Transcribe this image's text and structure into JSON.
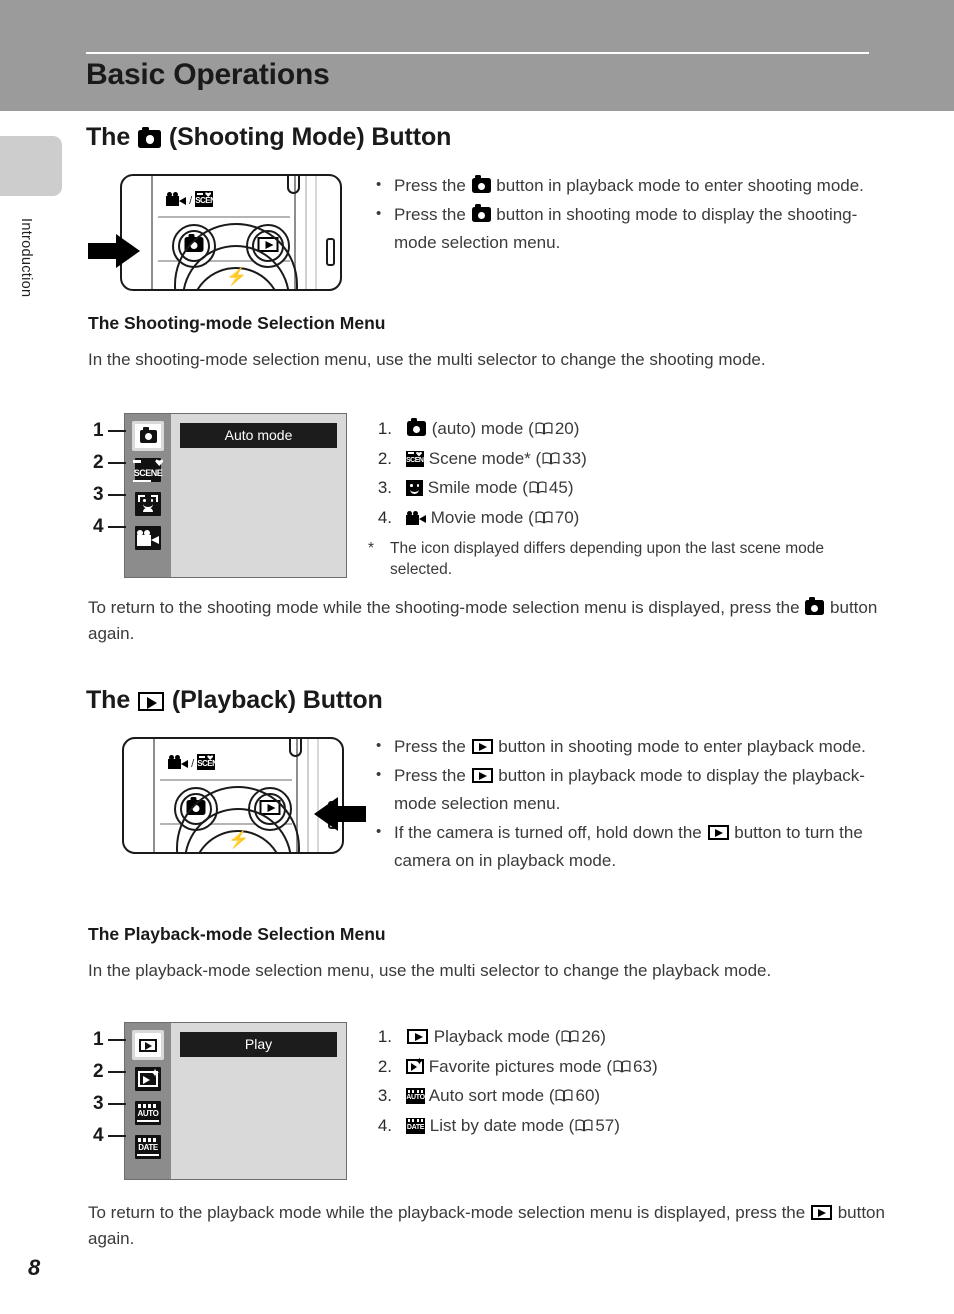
{
  "header": {
    "title": "Basic Operations"
  },
  "side_tab": {
    "label": "Introduction"
  },
  "page_number": "8",
  "sections": [
    {
      "heading_prefix": "The",
      "heading_icon": "shooting-mode-camera-icon",
      "heading_suffix": "(Shooting Mode) Button",
      "bullets": [
        {
          "pre": "Press the",
          "icon": "camera-icon",
          "post": "button in playback mode to enter shooting mode."
        },
        {
          "pre": "Press the",
          "icon": "camera-icon",
          "post": "button in shooting mode to display the shooting-mode selection menu."
        }
      ],
      "sub_heading": "The Shooting-mode Selection Menu",
      "intro": "In the shooting-mode selection menu, use the multi selector to change the shooting mode.",
      "menu": {
        "title": "Auto mode",
        "rail_items": [
          {
            "number": "1",
            "icon": "camera-icon",
            "selected": true
          },
          {
            "number": "2",
            "icon": "scene-icon",
            "selected": false
          },
          {
            "number": "3",
            "icon": "smile-icon",
            "selected": false
          },
          {
            "number": "4",
            "icon": "movie-icon",
            "selected": false
          }
        ]
      },
      "list": [
        {
          "num": "1.",
          "icon": "camera-icon",
          "label": "(auto) mode",
          "ref_open": "(",
          "page": "20",
          "ref_close": ")"
        },
        {
          "num": "2.",
          "icon": "scene-icon",
          "label": "Scene mode*",
          "ref_open": "(",
          "page": "33",
          "ref_close": ")"
        },
        {
          "num": "3.",
          "icon": "smile-icon",
          "label": "Smile mode",
          "ref_open": "(",
          "page": "45",
          "ref_close": ")"
        },
        {
          "num": "4.",
          "icon": "movie-icon",
          "label": "Movie mode",
          "ref_open": "(",
          "page": "70",
          "ref_close": ")"
        }
      ],
      "footnote_marker": "*",
      "footnote": "The icon displayed differs depending upon the last scene mode selected.",
      "closing_pre": "To return to the shooting mode while the shooting-mode selection menu is displayed, press the",
      "closing_icon": "camera-icon",
      "closing_post": "button again."
    },
    {
      "heading_prefix": "The",
      "heading_icon": "playback-icon",
      "heading_suffix": "(Playback) Button",
      "bullets": [
        {
          "pre": "Press the",
          "icon": "playback-icon",
          "post": "button in shooting mode to enter playback mode."
        },
        {
          "pre": "Press the",
          "icon": "playback-icon",
          "post": "button in playback mode to display the playback-mode selection menu."
        },
        {
          "pre": "If the camera is turned off, hold down the",
          "icon": "playback-icon",
          "post": "button to turn the camera on in playback mode."
        }
      ],
      "sub_heading": "The Playback-mode Selection Menu",
      "intro": "In the playback-mode selection menu, use the multi selector to change the playback mode.",
      "menu": {
        "title": "Play",
        "rail_items": [
          {
            "number": "1",
            "icon": "playback-icon",
            "selected": true
          },
          {
            "number": "2",
            "icon": "favorite-pictures-icon",
            "selected": false
          },
          {
            "number": "3",
            "icon": "auto-sort-icon",
            "selected": false
          },
          {
            "number": "4",
            "icon": "list-by-date-icon",
            "selected": false
          }
        ]
      },
      "list": [
        {
          "num": "1.",
          "icon": "playback-icon",
          "label": "Playback mode",
          "ref_open": "(",
          "page": "26",
          "ref_close": ")"
        },
        {
          "num": "2.",
          "icon": "favorite-pictures-icon",
          "label": "Favorite pictures mode",
          "ref_open": "(",
          "page": "63",
          "ref_close": ")"
        },
        {
          "num": "3.",
          "icon": "auto-sort-icon",
          "label": "Auto sort mode",
          "ref_open": "(",
          "page": "60",
          "ref_close": ")"
        },
        {
          "num": "4.",
          "icon": "list-by-date-icon",
          "label": "List by date mode",
          "ref_open": "(",
          "page": "57",
          "ref_close": ")"
        }
      ],
      "closing_pre": "To return to the playback mode while the playback-mode selection menu is displayed, press the",
      "closing_icon": "playback-icon",
      "closing_post": "button again."
    }
  ],
  "camera_figure": {
    "mode_label_movie": "movie-icon",
    "mode_label_separator": "/",
    "mode_label_scene": "SCENE",
    "flash_symbol": "flash-icon",
    "shoot_button_icon": "camera-icon",
    "play_button_icon": "playback-icon"
  },
  "icon_text": {
    "scene": "SCENE",
    "auto": "AUTO",
    "date": "DATE"
  }
}
